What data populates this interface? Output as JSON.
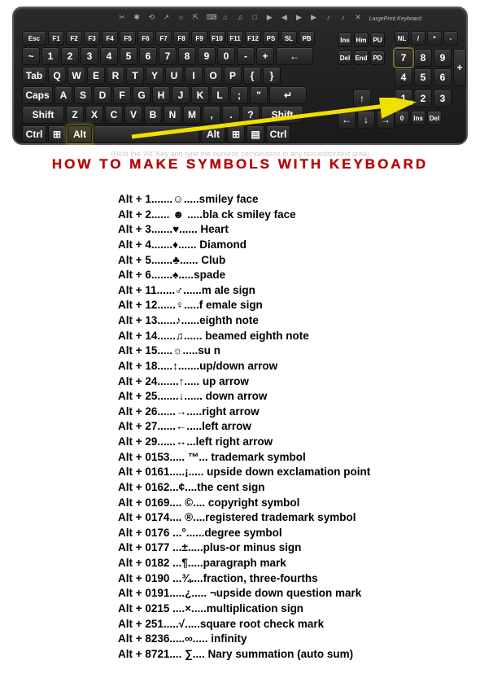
{
  "keyboard": {
    "brand": "LargePrint Keyboard",
    "instruction": "(Hold the 'Alt' Key and type the numeric combination in any text editor/text area)",
    "fn_row": [
      "Esc",
      "F1",
      "F2",
      "F3",
      "F4",
      "F5",
      "F6",
      "F7",
      "F8",
      "F9",
      "F10",
      "F11",
      "F12",
      "PS",
      "SL",
      "PB"
    ],
    "num_row": [
      "~",
      "1",
      "2",
      "3",
      "4",
      "5",
      "6",
      "7",
      "8",
      "9",
      "0",
      "-",
      "+",
      "←"
    ],
    "qwerty": [
      "Q",
      "W",
      "E",
      "R",
      "T",
      "Y",
      "U",
      "I",
      "O",
      "P",
      "{",
      "}"
    ],
    "home": [
      "A",
      "S",
      "D",
      "F",
      "G",
      "H",
      "J",
      "K",
      "L",
      ";",
      "\"",
      "↵"
    ],
    "zxcv": [
      "Z",
      "X",
      "C",
      "V",
      "B",
      "N",
      "M",
      ",",
      ".",
      "?"
    ],
    "nav": {
      "r1": [
        "Ins",
        "Hm",
        "PU"
      ],
      "r2": [
        "Del",
        "End",
        "PD"
      ]
    },
    "numpad": {
      "top": [
        "NL",
        "/",
        "*",
        "-"
      ],
      "r1": [
        "7",
        "8",
        "9"
      ],
      "r2": [
        "4",
        "5",
        "6"
      ],
      "r3": [
        "1",
        "2",
        "3"
      ],
      "bot": [
        "0",
        "Ins",
        "Del"
      ]
    }
  },
  "title": "HOW  TO  MAKE  SYMBOLS  WITH  KEYBOARD",
  "codes": [
    {
      "combo": "Alt + 1",
      "dots": ".......",
      "sym": "☺",
      "dots2": ".....",
      "desc": "smiley face"
    },
    {
      "combo": "Alt + 2",
      "dots": "...... ",
      "sym": "☻",
      "dots2": " .....",
      "desc": "bla ck smiley face"
    },
    {
      "combo": "Alt + 3",
      "dots": ".......",
      "sym": "♥",
      "dots2": "...... ",
      "desc": "Heart"
    },
    {
      "combo": "Alt + 4",
      "dots": ".......",
      "sym": "♦",
      "dots2": "...... ",
      "desc": "Diamond"
    },
    {
      "combo": "Alt + 5",
      "dots": ".......",
      "sym": "♣",
      "dots2": "...... ",
      "desc": "Club"
    },
    {
      "combo": "Alt + 6",
      "dots": ".......",
      "sym": "♠",
      "dots2": ".....",
      "desc": "spade"
    },
    {
      "combo": "Alt + 11",
      "dots": "......",
      "sym": "♂",
      "dots2": "......",
      "desc": "m ale sign"
    },
    {
      "combo": "Alt + 12",
      "dots": "......",
      "sym": "♀",
      "dots2": ".....",
      "desc": "f emale sign"
    },
    {
      "combo": "Alt + 13",
      "dots": "......",
      "sym": "♪",
      "dots2": "......",
      "desc": "eighth note"
    },
    {
      "combo": "Alt + 14",
      "dots": "......",
      "sym": "♫",
      "dots2": "...... ",
      "desc": "beamed eighth note"
    },
    {
      "combo": "Alt + 15",
      "dots": ".....",
      "sym": "☼",
      "dots2": ".....",
      "desc": "su n"
    },
    {
      "combo": "Alt + 18",
      "dots": ".....",
      "sym": "↕",
      "dots2": ".......",
      "desc": "up/down arrow"
    },
    {
      "combo": "Alt + 24",
      "dots": ".......",
      "sym": "↑",
      "dots2": "..... ",
      "desc": "up arrow"
    },
    {
      "combo": "Alt + 25",
      "dots": ".......",
      "sym": "↓",
      "dots2": "...... ",
      "desc": "down arrow"
    },
    {
      "combo": "Alt + 26",
      "dots": "......",
      "sym": "→",
      "dots2": ".....",
      "desc": "right arrow"
    },
    {
      "combo": "Alt + 27",
      "dots": "......",
      "sym": "←",
      "dots2": ".....",
      "desc": "left arrow"
    },
    {
      "combo": "Alt + 29",
      "dots": "......",
      "sym": "↔",
      "dots2": "...",
      "desc": "left right arrow"
    },
    {
      "combo": "Alt + 0153",
      "dots": "..... ",
      "sym": "™",
      "dots2": "... ",
      "desc": "trademark symbol"
    },
    {
      "combo": "Alt + 0161",
      "dots": ".....",
      "sym": "¡",
      "dots2": "..... ",
      "desc": "upside down exclamation point"
    },
    {
      "combo": "Alt + 0162",
      "dots": "...",
      "sym": "¢",
      "dots2": "....",
      "desc": "the cent sign"
    },
    {
      "combo": "Alt + 0169",
      "dots": ".... ",
      "sym": "©",
      "dots2": ".... ",
      "desc": "copyright symbol"
    },
    {
      "combo": "Alt + 0174",
      "dots": ".... ",
      "sym": "®",
      "dots2": "....",
      "desc": "registered  trademark symbol"
    },
    {
      "combo": "Alt + 0176",
      "dots": " ...",
      "sym": "°",
      "dots2": "......",
      "desc": "degree symbol"
    },
    {
      "combo": "Alt + 0177",
      "dots": " ...",
      "sym": "±",
      "dots2": ".....",
      "desc": "plus-or minus sign"
    },
    {
      "combo": "Alt + 0182",
      "dots": " ...",
      "sym": "¶",
      "dots2": ".....",
      "desc": "paragraph mark"
    },
    {
      "combo": "Alt + 0190",
      "dots": " ...",
      "sym": "¾",
      "dots2": "....",
      "desc": "fraction, three-fourths"
    },
    {
      "combo": "Alt + 0191",
      "dots": ".....",
      "sym": "¿",
      "dots2": "..... ",
      "desc": "¬upside down question mark"
    },
    {
      "combo": "Alt + 0215",
      "dots": " ....",
      "sym": "×",
      "dots2": ".....",
      "desc": "multiplication sign"
    },
    {
      "combo": "Alt + 251",
      "dots": ".....",
      "sym": "√",
      "dots2": ".....",
      "desc": "square root check mark"
    },
    {
      "combo": "Alt + 8236",
      "dots": ".....",
      "sym": "∞",
      "dots2": "..... ",
      "desc": "infinity"
    },
    {
      "combo": "Alt + 8721",
      "dots": ".... ",
      "sym": "∑",
      "dots2": ".... ",
      "desc": "Nary summation (auto sum)"
    }
  ]
}
